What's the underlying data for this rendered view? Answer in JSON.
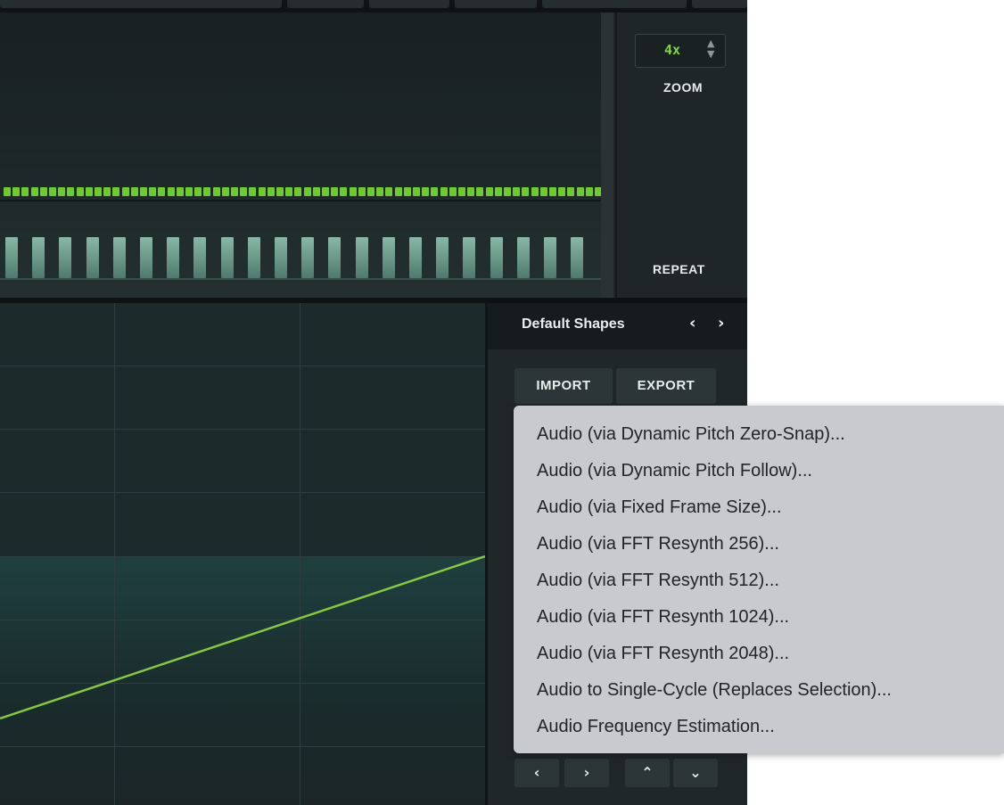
{
  "zoom": {
    "value": "4x",
    "label": "ZOOM",
    "stepper_icon": "up-down-arrows-icon"
  },
  "repeat": {
    "label": "REPEAT"
  },
  "shapes_panel": {
    "title": "Default Shapes",
    "prev_icon": "chevron-left-icon",
    "next_icon": "chevron-right-icon",
    "import_label": "IMPORT",
    "export_label": "EXPORT",
    "bottom_buttons": [
      {
        "name": "previous",
        "glyph": "‹"
      },
      {
        "name": "next",
        "glyph": "›"
      },
      {
        "name": "move-up",
        "glyph": "⌃"
      },
      {
        "name": "move-down",
        "glyph": "⌄"
      }
    ]
  },
  "import_menu": {
    "items": [
      "Audio (via Dynamic Pitch Zero-Snap)...",
      "Audio (via Dynamic Pitch Follow)...",
      "Audio (via Fixed Frame Size)...",
      "Audio (via FFT Resynth 256)...",
      "Audio (via FFT Resynth 512)...",
      "Audio (via FFT Resynth 1024)...",
      "Audio (via FFT Resynth 2048)...",
      "Audio to Single-Cycle (Replaces Selection)...",
      "Audio Frequency Estimation..."
    ]
  },
  "colors": {
    "accent_green": "#84d63d",
    "frame_marker": "#6ecb2d",
    "curve": "#86c93a",
    "menu_bg": "#c9cacf",
    "panel_bg": "#202729"
  }
}
